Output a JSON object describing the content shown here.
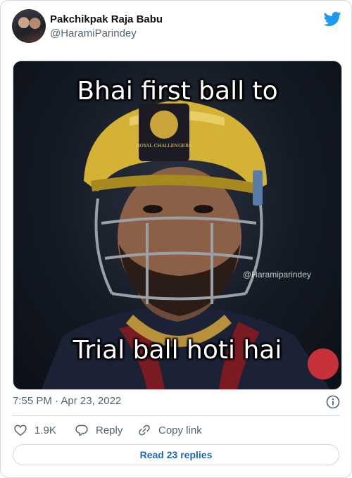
{
  "author": {
    "display_name": "Pakchikpak Raja Babu",
    "handle": "@HaramiParindey",
    "avatar_icon": "avatar-photo"
  },
  "brand": {
    "icon": "twitter-bird-icon",
    "color": "#1d9bf0"
  },
  "media": {
    "caption_top": "Bhai first ball to",
    "caption_bottom": "Trial ball hoti hai",
    "watermark": "@Haramiparindey",
    "helmet_badge": "ROYAL CHALLENGERS"
  },
  "meta": {
    "timestamp": "7:55 PM · Apr 23, 2022",
    "info_icon": "info-icon"
  },
  "actions": {
    "like_count": "1.9K",
    "reply_label": "Reply",
    "copy_label": "Copy link"
  },
  "footer": {
    "replies_label": "Read 23 replies"
  },
  "colors": {
    "link": "#1d67b6",
    "muted": "#536471",
    "border": "#cfd9de"
  }
}
